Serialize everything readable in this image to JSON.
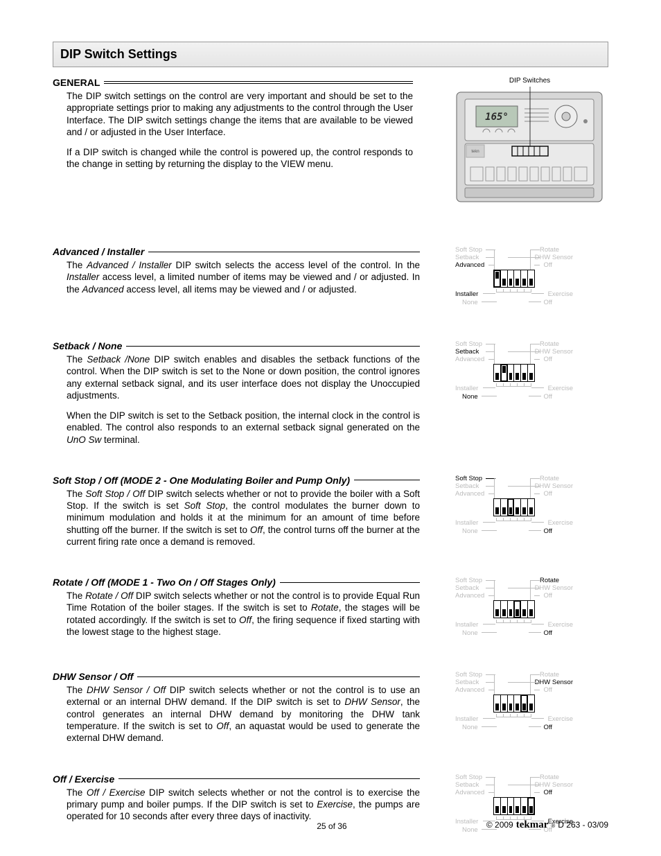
{
  "title": "DIP Switch Settings",
  "general": {
    "heading": "GENERAL",
    "p1": "The DIP switch settings on the control are very important and should be set to the appropriate settings prior to making any adjustments to the control through the User Interface. The DIP switch settings change the items that are available to be viewed and / or adjusted in the User Interface.",
    "p2": "If a DIP switch is changed while the control is powered up, the control responds to the change in setting by returning the display to the VIEW menu.",
    "fig_caption": "DIP Switches"
  },
  "dip_labels": {
    "tl1": "Soft Stop",
    "tl2": "Setback",
    "tl3": "Advanced",
    "tr1": "Rotate",
    "tr2": "DHW Sensor",
    "tr3": "Off",
    "bl1": "Installer",
    "bl2": "None",
    "br1": "Exercise",
    "br2": "Off"
  },
  "sections": [
    {
      "heading": "Advanced / Installer",
      "paragraphs": [
        "The <i>Advanced / Installer</i> DIP switch selects the access level of the control. In the <i>Installer</i> access level, a limited number of items may be viewed and / or adjusted. In the <i>Advanced</i> access level, all items may be viewed and / or adjusted."
      ],
      "active_top": [
        "tl3"
      ],
      "active_bottom": [
        "bl1"
      ],
      "switches": [
        "up",
        "down",
        "down",
        "down",
        "down",
        "down"
      ],
      "highlight": 0
    },
    {
      "heading": "Setback / None",
      "paragraphs": [
        "The <i>Setback /None</i> DIP switch enables and disables the setback functions of the control. When the DIP switch is set to the None or down position, the control ignores any external setback signal, and its user interface does not display the Unoccupied adjustments.",
        "When the DIP switch is set to the Setback position, the internal clock in the control is enabled. The control also responds to an external setback signal generated on the <i>UnO Sw</i> terminal."
      ],
      "active_top": [
        "tl2"
      ],
      "active_bottom": [
        "bl2"
      ],
      "switches": [
        "down",
        "up",
        "down",
        "down",
        "down",
        "down"
      ],
      "highlight": 1
    },
    {
      "heading": "Soft Stop / Off (MODE 2 - One Modulating Boiler and Pump Only)",
      "paragraphs": [
        "The <i>Soft Stop / Off</i> DIP switch selects whether or not to provide the boiler with a Soft Stop. If the switch is set <i>Soft Stop</i>, the control modulates the burner down to minimum modulation and holds it at the minimum for an amount of time before shutting off the burner. If the switch is set to <i>Off</i>, the control turns off the burner at the current firing rate once a demand is removed."
      ],
      "active_top": [
        "tl1"
      ],
      "active_bottom": [
        "br2"
      ],
      "switches": [
        "down",
        "down",
        "down",
        "down",
        "down",
        "down"
      ],
      "highlight": 2
    },
    {
      "heading": "Rotate / Off (MODE 1 - Two On / Off Stages Only)",
      "paragraphs": [
        "The <i>Rotate / Off</i> DIP switch selects whether or not the control is to provide Equal Run Time Rotation of the boiler stages. If the switch is set to <i>Rotate</i>, the stages will be rotated accordingly. If the switch is set to <i>Off</i>, the firing sequence if fixed starting with the lowest stage to the highest stage."
      ],
      "active_top": [
        "tr1"
      ],
      "active_bottom": [
        "br2"
      ],
      "switches": [
        "down",
        "down",
        "down",
        "down",
        "down",
        "down"
      ],
      "highlight": 3
    },
    {
      "heading": "DHW Sensor / Off",
      "paragraphs": [
        "The <i>DHW Sensor / Off</i> DIP switch selects whether or not the control is to use an external or an internal DHW demand. If the DIP switch is set to <i>DHW Sensor</i>, the control generates an internal DHW demand by monitoring the DHW tank temperature. If the switch is set to <i>Off</i>, an aquastat would be used to generate the external DHW demand."
      ],
      "active_top": [
        "tr2"
      ],
      "active_bottom": [
        "br2"
      ],
      "switches": [
        "down",
        "down",
        "down",
        "down",
        "down",
        "down"
      ],
      "highlight": 4
    },
    {
      "heading": "Off / Exercise",
      "paragraphs": [
        "The <i>Off / Exercise</i> DIP switch selects whether or not the control is to exercise the primary pump and boiler pumps. If the DIP switch is set to <i>Exercise</i>, the pumps are operated for 10 seconds after every three days of inactivity."
      ],
      "active_top": [
        "tr3"
      ],
      "active_bottom": [
        "br1"
      ],
      "switches": [
        "down",
        "down",
        "down",
        "down",
        "down",
        "down"
      ],
      "highlight": 5
    }
  ],
  "footer": {
    "page": "25 of 36",
    "copyright": "© 2009",
    "brand": "tekmar",
    "doc": " D 263 - 03/09"
  }
}
